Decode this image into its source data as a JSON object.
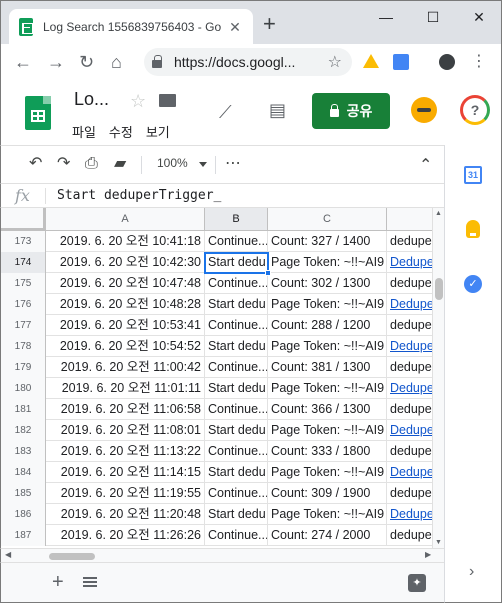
{
  "browser": {
    "tab_title": "Log Search 1556839756403 - Go",
    "tab_close": "✕",
    "new_tab": "+",
    "url": "https://docs.googl...",
    "window_minimize": "—",
    "window_maximize": "☐",
    "window_close": "✕"
  },
  "docs": {
    "title": "Lo...",
    "menus": [
      "파일",
      "수정",
      "보기"
    ],
    "share_label": "공유"
  },
  "toolbar": {
    "zoom": "100%",
    "more": "⋯",
    "collapse": "⌃"
  },
  "formula_bar": {
    "fx": "fx",
    "content": "Start deduperTrigger_"
  },
  "grid": {
    "columns": [
      "A",
      "B",
      "C",
      ""
    ],
    "active_column": "B",
    "selected_row": "174",
    "rows": [
      {
        "num": "173",
        "a": "2019. 6. 20 오전 10:41:18",
        "b": "Continue...",
        "c": "Count: 327 / 1400",
        "d": "dedupe",
        "d_link": false
      },
      {
        "num": "174",
        "a": "2019. 6. 20 오전 10:42:30",
        "b": "Start dedu",
        "c": "Page Token: ~!!~AI9",
        "d": "Dedupe",
        "d_link": true
      },
      {
        "num": "175",
        "a": "2019. 6. 20 오전 10:47:48",
        "b": "Continue...",
        "c": "Count: 302 / 1300",
        "d": "dedupe",
        "d_link": false
      },
      {
        "num": "176",
        "a": "2019. 6. 20 오전 10:48:28",
        "b": "Start dedu",
        "c": "Page Token: ~!!~AI9",
        "d": "Dedupe",
        "d_link": true
      },
      {
        "num": "177",
        "a": "2019. 6. 20 오전 10:53:41",
        "b": "Continue...",
        "c": "Count: 288 / 1200",
        "d": "dedupe",
        "d_link": false
      },
      {
        "num": "178",
        "a": "2019. 6. 20 오전 10:54:52",
        "b": "Start dedu",
        "c": "Page Token: ~!!~AI9",
        "d": "Dedupe",
        "d_link": true
      },
      {
        "num": "179",
        "a": "2019. 6. 20 오전 11:00:42",
        "b": "Continue...",
        "c": "Count: 381 / 1300",
        "d": "dedupe",
        "d_link": false
      },
      {
        "num": "180",
        "a": "2019. 6. 20 오전 11:01:11",
        "b": "Start dedu",
        "c": "Page Token: ~!!~AI9",
        "d": "Dedupe",
        "d_link": true
      },
      {
        "num": "181",
        "a": "2019. 6. 20 오전 11:06:58",
        "b": "Continue...",
        "c": "Count: 366 / 1300",
        "d": "dedupe",
        "d_link": false
      },
      {
        "num": "182",
        "a": "2019. 6. 20 오전 11:08:01",
        "b": "Start dedu",
        "c": "Page Token: ~!!~AI9",
        "d": "Dedupe",
        "d_link": true
      },
      {
        "num": "183",
        "a": "2019. 6. 20 오전 11:13:22",
        "b": "Continue...",
        "c": "Count: 333 / 1800",
        "d": "dedupe",
        "d_link": false
      },
      {
        "num": "184",
        "a": "2019. 6. 20 오전 11:14:15",
        "b": "Start dedu",
        "c": "Page Token: ~!!~AI9",
        "d": "Dedupe",
        "d_link": true
      },
      {
        "num": "185",
        "a": "2019. 6. 20 오전 11:19:55",
        "b": "Continue...",
        "c": "Count: 309 / 1900",
        "d": "dedupe",
        "d_link": false
      },
      {
        "num": "186",
        "a": "2019. 6. 20 오전 11:20:48",
        "b": "Start dedu",
        "c": "Page Token: ~!!~AI9",
        "d": "Dedupe",
        "d_link": true
      },
      {
        "num": "187",
        "a": "2019. 6. 20 오전 11:26:26",
        "b": "Continue...",
        "c": "Count: 274 / 2000",
        "d": "dedupe",
        "d_link": false
      }
    ]
  },
  "sidepanel": {
    "calendar_day": "31",
    "tasks_glyph": "✓",
    "expand": "›"
  },
  "sheetbar": {
    "add": "+",
    "explore_glyph": "✦"
  },
  "colors": {
    "share_green": "#188038",
    "selection_blue": "#1a73e8",
    "link_blue": "#1155cc"
  }
}
